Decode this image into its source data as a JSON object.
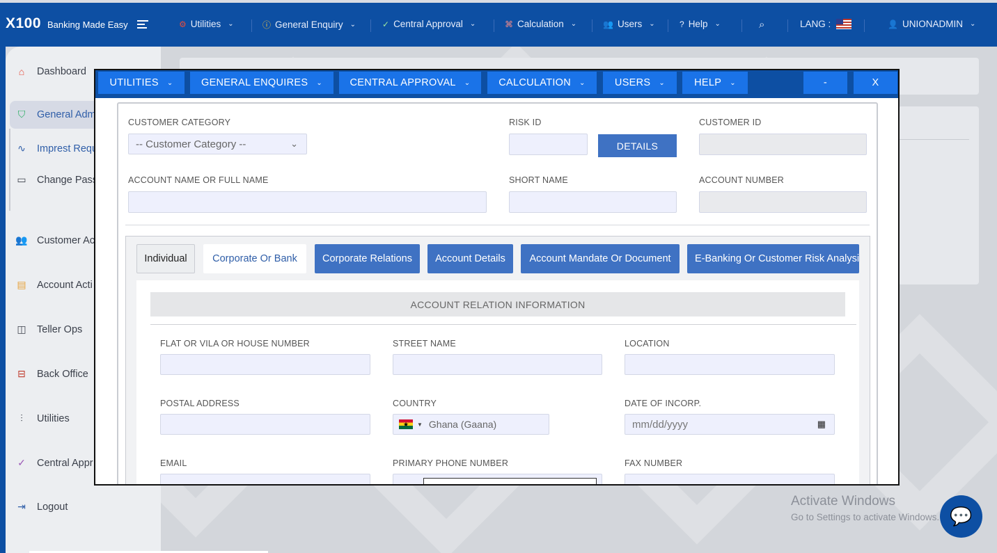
{
  "topbar": {
    "brand": "X100",
    "tagline": "Banking Made Easy",
    "nav": [
      {
        "label": "Utilities",
        "icon": "⚙"
      },
      {
        "label": "General Enquiry",
        "icon": "ⓘ"
      },
      {
        "label": "Central Approval",
        "icon": "✓"
      },
      {
        "label": "Calculation",
        "icon": "⌘"
      },
      {
        "label": "Users",
        "icon": "👥"
      },
      {
        "label": "Help",
        "icon": "?"
      }
    ],
    "lang_label": "LANG :",
    "user": "UNIONADMIN"
  },
  "sidebar": {
    "items": [
      {
        "label": "Dashboard",
        "icon": "⌂"
      },
      {
        "label": "General Adm",
        "icon": "⛉"
      },
      {
        "label": "Imprest Requ",
        "icon": "∿"
      },
      {
        "label": "Change Pass",
        "icon": "▭"
      },
      {
        "label": "Customer Ac",
        "icon": "👥"
      },
      {
        "label": "Account Acti",
        "icon": "▤"
      },
      {
        "label": "Teller Ops",
        "icon": "◫"
      },
      {
        "label": "Back Office",
        "icon": "⊟"
      },
      {
        "label": "Utilities",
        "icon": "⫶"
      },
      {
        "label": "Central Appr",
        "icon": "✓"
      },
      {
        "label": "Logout",
        "icon": "⇥"
      }
    ]
  },
  "modal": {
    "menu": [
      {
        "label": "UTILITIES"
      },
      {
        "label": "GENERAL ENQUIRES"
      },
      {
        "label": "CENTRAL APPROVAL"
      },
      {
        "label": "CALCULATION"
      },
      {
        "label": "USERS"
      },
      {
        "label": "HELP"
      }
    ],
    "minimize": "-",
    "close": "X",
    "form": {
      "customer_category_label": "CUSTOMER CATEGORY",
      "customer_category_value": "-- Customer Category --",
      "risk_id_label": "RISK ID",
      "risk_id_value": "",
      "details_button": "DETAILS",
      "customer_id_label": "CUSTOMER ID",
      "customer_id_value": "",
      "account_name_label": "ACCOUNT NAME OR FULL NAME",
      "account_name_value": "",
      "short_name_label": "SHORT NAME",
      "short_name_value": "",
      "account_number_label": "ACCOUNT NUMBER",
      "account_number_value": ""
    },
    "tabs": [
      {
        "label": "Individual"
      },
      {
        "label": "Corporate Or Bank"
      },
      {
        "label": "Corporate Relations"
      },
      {
        "label": "Account Details"
      },
      {
        "label": "Account Mandate Or Document"
      },
      {
        "label": "E-Banking Or Customer Risk Analysis"
      }
    ],
    "section_title": "ACCOUNT RELATION INFORMATION",
    "fields": {
      "house_label": "FLAT OR VILA OR HOUSE NUMBER",
      "street_label": "STREET NAME",
      "location_label": "LOCATION",
      "postal_label": "POSTAL ADDRESS",
      "country_label": "COUNTRY",
      "country_value": "Ghana (Gaana)",
      "date_label": "DATE OF INCORP.",
      "date_placeholder": "mm/dd/yyyy",
      "email_label": "EMAIL",
      "phone_label": "PRIMARY PHONE NUMBER",
      "fax_label": "FAX NUMBER"
    }
  },
  "watermark": {
    "line1": "Activate Windows",
    "line2": "Go to Settings to activate Windows."
  }
}
